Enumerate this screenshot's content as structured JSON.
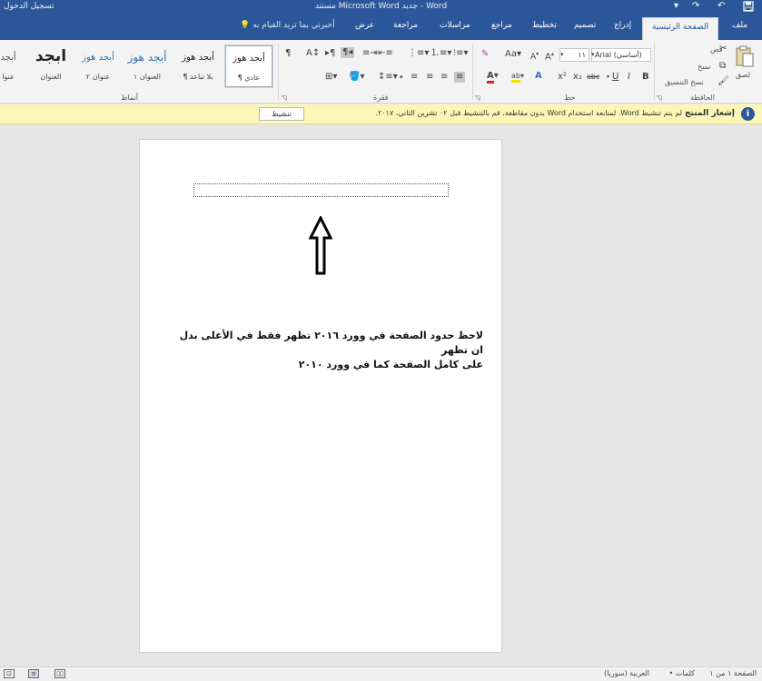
{
  "titlebar": {
    "title": "مستند Microsoft Word جديد - Word",
    "signin": "تسجيل الدخول",
    "save_icon": "save-icon",
    "undo_icon": "undo-icon",
    "redo_icon": "redo-icon",
    "customize_icon": "customize-quick-access-icon"
  },
  "tabs": {
    "file": "ملف",
    "home": "الصفحة الرئيسية",
    "insert": "إدراج",
    "design": "تصميم",
    "layout": "تخطيط",
    "references": "مراجع",
    "mailings": "مراسلات",
    "review": "مراجعة",
    "view": "عرض",
    "tell_me": "أخبرني بما تريد القيام به"
  },
  "ribbon": {
    "clipboard": {
      "paste": "لصق",
      "cut": "قص",
      "copy": "نسخ",
      "format_painter": "نسخ التنسيق",
      "label": "الحافظة"
    },
    "font": {
      "font_name": "Arial (أساسي)",
      "font_size": "١١",
      "bold": "B",
      "italic": "I",
      "underline": "U",
      "strike": "abc",
      "subscript": "x₂",
      "superscript": "x²",
      "change_case": "Aa",
      "label": "خط"
    },
    "paragraph": {
      "label": "فقرة"
    },
    "styles": {
      "label": "أنماط",
      "items": [
        {
          "sample": "أبجد هوز",
          "name": "¶ عادي"
        },
        {
          "sample": "أبجد هوز",
          "name": "¶ بلا تباعد"
        },
        {
          "sample": "أبجد هوز",
          "name": "العنوان ١"
        },
        {
          "sample": "أبجد هوز",
          "name": "عنوان ٢"
        },
        {
          "sample": "ابجد",
          "name": "العنوان"
        },
        {
          "sample": "أبجد",
          "name": "عنوا"
        }
      ]
    }
  },
  "message_bar": {
    "title": "إشعار المنتج",
    "text": "لم يتم تنشيط Word. لمتابعة استخدام Word بدون مقاطعة، قم بالتنشيط قبل ٠٢ تشرين الثاني، ٢٠١٧.",
    "activate_button": "تنشيط"
  },
  "document": {
    "line1": "لاحظ حدود الصفحة في وورد ٢٠١٦ تظهر فقط في الأعلى بدل ان تظهر",
    "line2": "على كامل الصفحة كما في وورد ٢٠١٠"
  },
  "status": {
    "page": "الصفحة ١ من ١",
    "words": "• كلمات",
    "language": "العربية (سوريا)"
  },
  "colors": {
    "accent": "#2b579a",
    "message_bar": "#fcf7b6"
  }
}
